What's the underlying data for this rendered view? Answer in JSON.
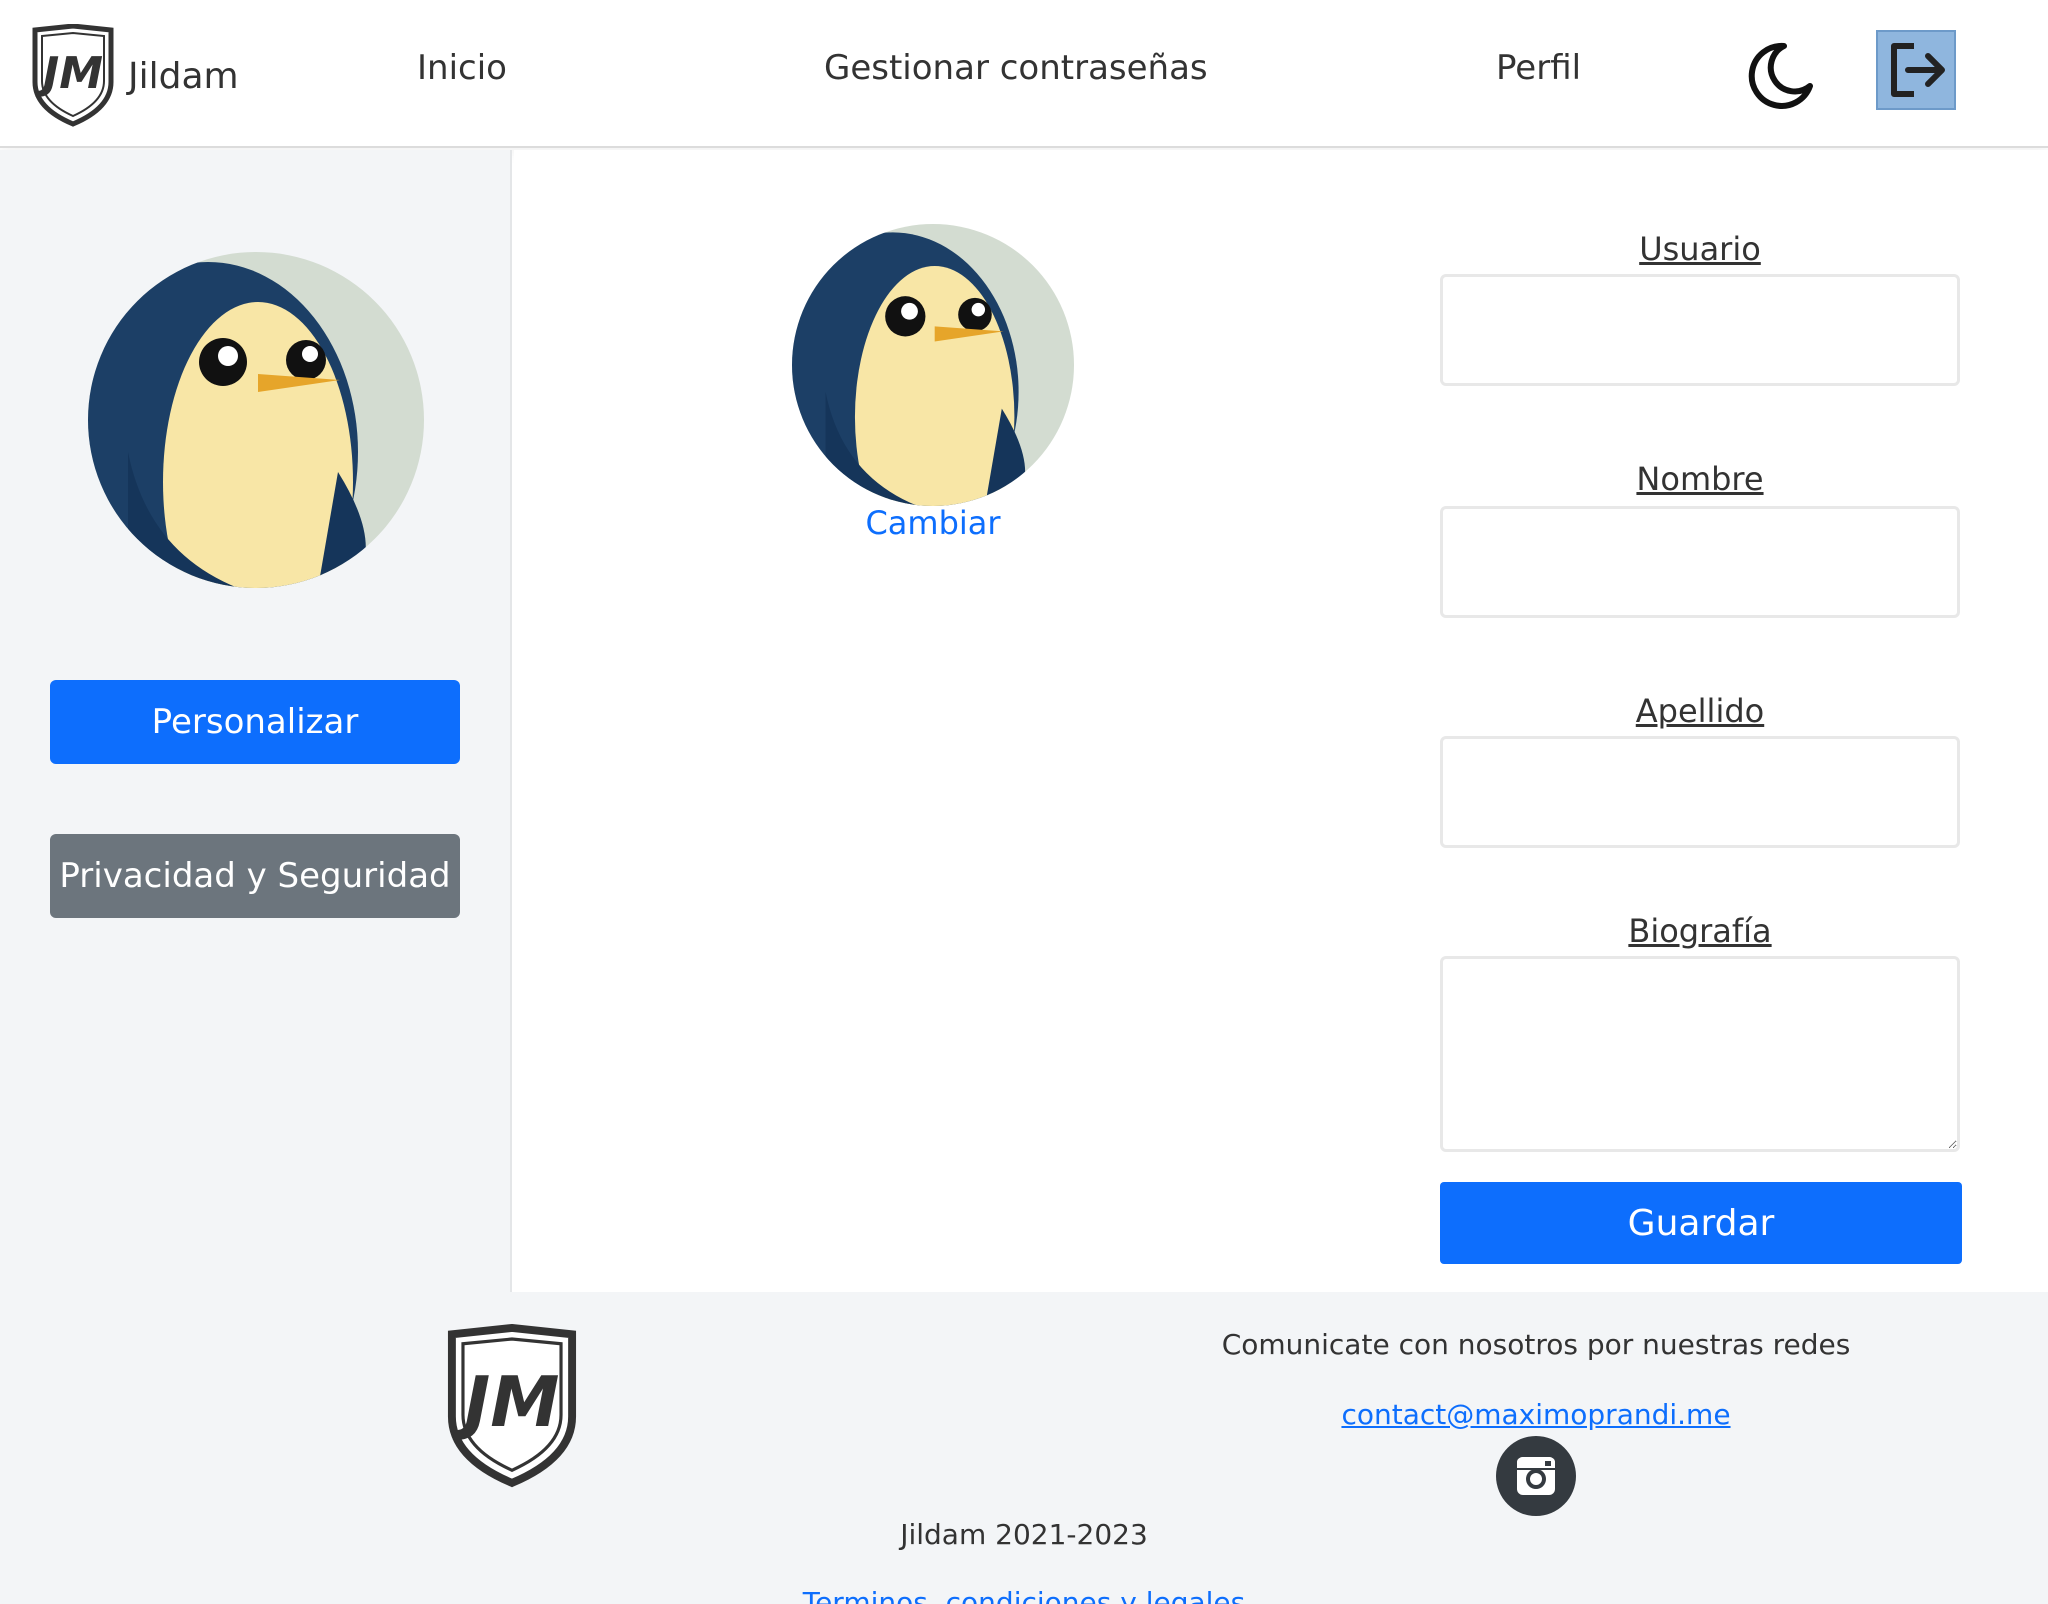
{
  "navbar": {
    "brand": "Jildam",
    "links": [
      "Inicio",
      "Gestionar contraseñas",
      "Perfil"
    ]
  },
  "sidebar": {
    "buttons": [
      "Personalizar",
      "Privacidad y Seguridad"
    ]
  },
  "profile": {
    "change_label": "Cambiar",
    "fields": {
      "usuario": "Usuario",
      "nombre": "Nombre",
      "apellido": "Apellido",
      "biografia": "Biografía"
    },
    "save_label": "Guardar"
  },
  "footer": {
    "contact_text": "Comunicate con nosotros por nuestras redes",
    "email": "contact@maximoprandi.me",
    "copyright": "Jildam 2021-2023",
    "terms": "Terminos, condiciones y legales"
  },
  "colors": {
    "primary": "#0d6efd",
    "secondary": "#6c757d",
    "logout_bg": "#8fb6de"
  }
}
